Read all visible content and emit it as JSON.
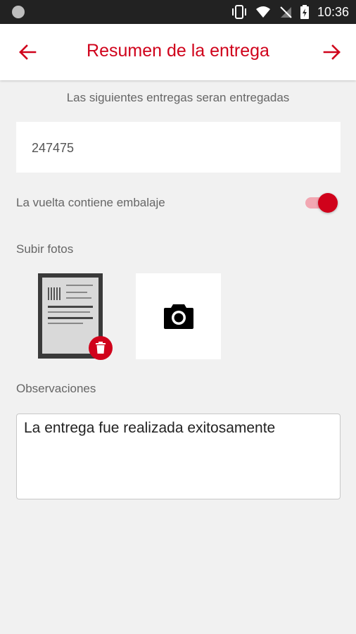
{
  "status_bar": {
    "time": "10:36"
  },
  "app_bar": {
    "title": "Resumen de la entrega",
    "back_icon": "arrow-left-icon",
    "next_icon": "arrow-right-icon"
  },
  "subtitle": "Las siguientes entregas seran entregadas",
  "delivery": {
    "id": "247475"
  },
  "packaging": {
    "label": "La vuelta contiene embalaje",
    "enabled": true
  },
  "photos": {
    "label": "Subir fotos",
    "delete_icon": "trash-icon",
    "add_icon": "camera-icon"
  },
  "observations": {
    "label": "Observaciones",
    "value": "La entrega fue realizada exitosamente"
  },
  "colors": {
    "accent": "#d0021b",
    "background": "#f1f1f1"
  }
}
